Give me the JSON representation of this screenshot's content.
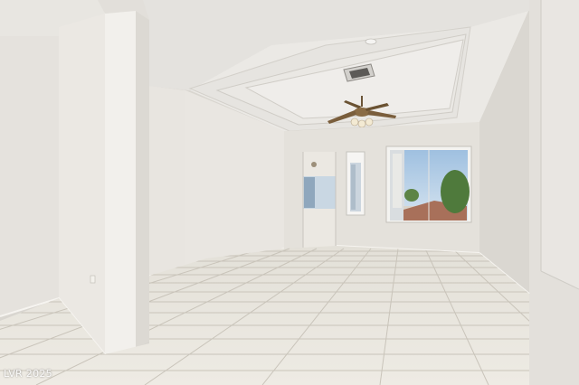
{
  "photo": {
    "subject": "empty-room-interior",
    "watermark": "LVR 2025",
    "colors": {
      "wall": "#e6e3de",
      "wall_shadow": "#d5d2cc",
      "ceiling": "#ebe9e5",
      "floor_tile": "#e7e4dc",
      "grout": "#c9c4ba",
      "sky": "#bcd4ea",
      "foliage": "#4f7a3c"
    }
  }
}
